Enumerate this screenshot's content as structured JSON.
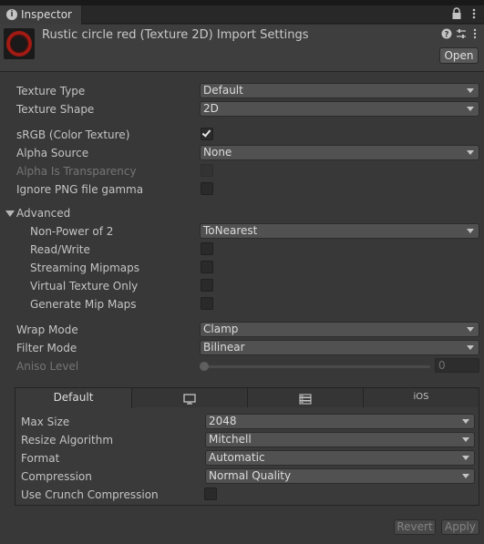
{
  "tab": {
    "title": "Inspector",
    "info_icon": "info-icon",
    "lock_icon": "lock-icon",
    "menu_icon": "kebab-menu-icon"
  },
  "header": {
    "title": "Rustic circle red (Texture 2D) Import Settings",
    "open_label": "Open",
    "help_icon": "help-icon",
    "presets_icon": "sliders-icon",
    "menu_icon": "kebab-menu-icon",
    "thumbnail_colors": {
      "ring": "#a11a14",
      "background": "#1a1a1a"
    }
  },
  "settings": {
    "texture_type": {
      "label": "Texture Type",
      "value": "Default"
    },
    "texture_shape": {
      "label": "Texture Shape",
      "value": "2D"
    },
    "srgb": {
      "label": "sRGB (Color Texture)",
      "checked": true
    },
    "alpha_source": {
      "label": "Alpha Source",
      "value": "None"
    },
    "alpha_transparency": {
      "label": "Alpha Is Transparency",
      "checked": false,
      "disabled": true
    },
    "ignore_png_gamma": {
      "label": "Ignore PNG file gamma",
      "checked": false
    }
  },
  "advanced": {
    "label": "Advanced",
    "non_power_of_2": {
      "label": "Non-Power of 2",
      "value": "ToNearest"
    },
    "read_write": {
      "label": "Read/Write",
      "checked": false
    },
    "streaming_mipmaps": {
      "label": "Streaming Mipmaps",
      "checked": false
    },
    "virtual_texture": {
      "label": "Virtual Texture Only",
      "checked": false
    },
    "generate_mip_maps": {
      "label": "Generate Mip Maps",
      "checked": false
    }
  },
  "sampling": {
    "wrap_mode": {
      "label": "Wrap Mode",
      "value": "Clamp"
    },
    "filter_mode": {
      "label": "Filter Mode",
      "value": "Bilinear"
    },
    "aniso_level": {
      "label": "Aniso Level",
      "value": "0",
      "slider_fraction": 0
    }
  },
  "platform": {
    "tabs": [
      {
        "label": "Default",
        "icon": null
      },
      {
        "label": "",
        "icon": "monitor-icon"
      },
      {
        "label": "",
        "icon": "server-icon"
      },
      {
        "label": "iOS",
        "icon": null
      }
    ],
    "max_size": {
      "label": "Max Size",
      "value": "2048"
    },
    "resize_algorithm": {
      "label": "Resize Algorithm",
      "value": "Mitchell"
    },
    "format": {
      "label": "Format",
      "value": "Automatic"
    },
    "compression": {
      "label": "Compression",
      "value": "Normal Quality"
    },
    "use_crunch": {
      "label": "Use Crunch Compression",
      "checked": false
    }
  },
  "footer": {
    "revert_label": "Revert",
    "apply_label": "Apply"
  }
}
